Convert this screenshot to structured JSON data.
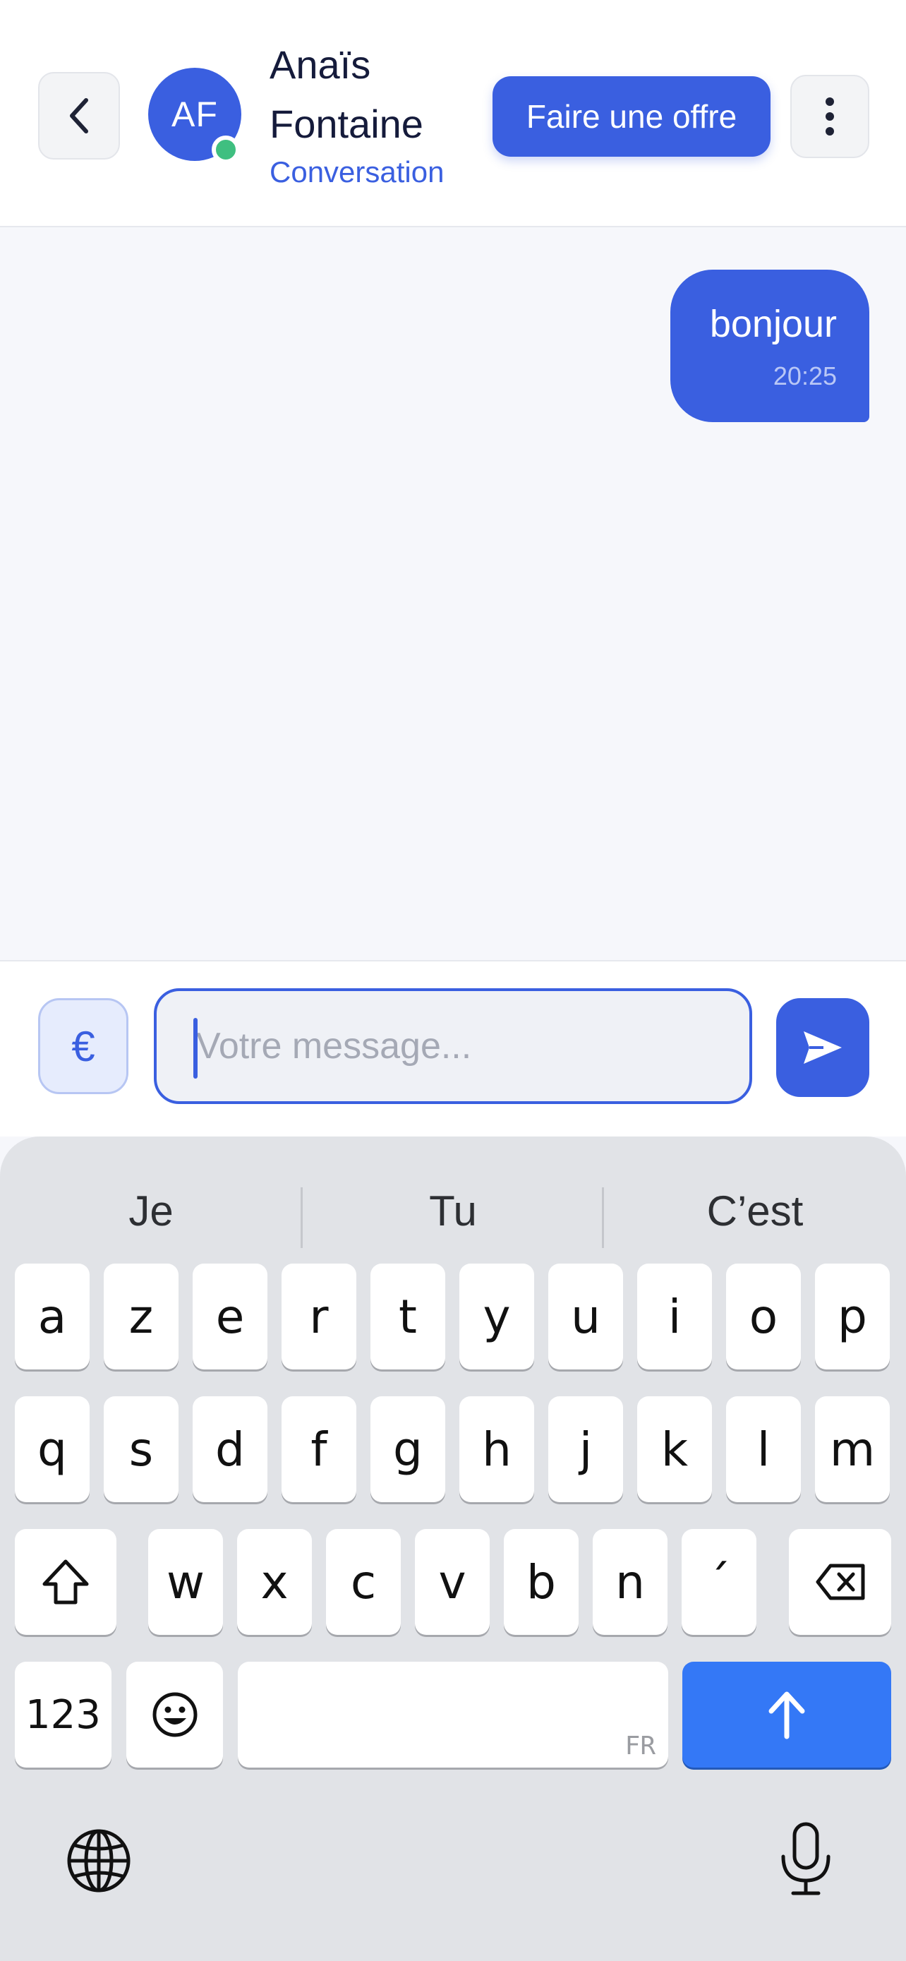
{
  "header": {
    "avatar_initials": "AF",
    "contact_name": "Anaïs Fontaine",
    "subtitle": "Conversation",
    "offer_label": "Faire une offre"
  },
  "messages": [
    {
      "text": "bonjour",
      "time": "20:25",
      "sender": "me"
    }
  ],
  "composer": {
    "currency_symbol": "€",
    "placeholder": "Votre message...",
    "value": ""
  },
  "keyboard": {
    "suggestions": [
      "Je",
      "Tu",
      "C’est"
    ],
    "row1": [
      "a",
      "z",
      "e",
      "r",
      "t",
      "y",
      "u",
      "i",
      "o",
      "p"
    ],
    "row2": [
      "q",
      "s",
      "d",
      "f",
      "g",
      "h",
      "j",
      "k",
      "l",
      "m"
    ],
    "row3": [
      "w",
      "x",
      "c",
      "v",
      "b",
      "n",
      "´"
    ],
    "numbers_label": "123",
    "language_label": "FR"
  },
  "colors": {
    "accent": "#3a5fe0",
    "online": "#3fbf80",
    "return_key": "#3478f6"
  }
}
